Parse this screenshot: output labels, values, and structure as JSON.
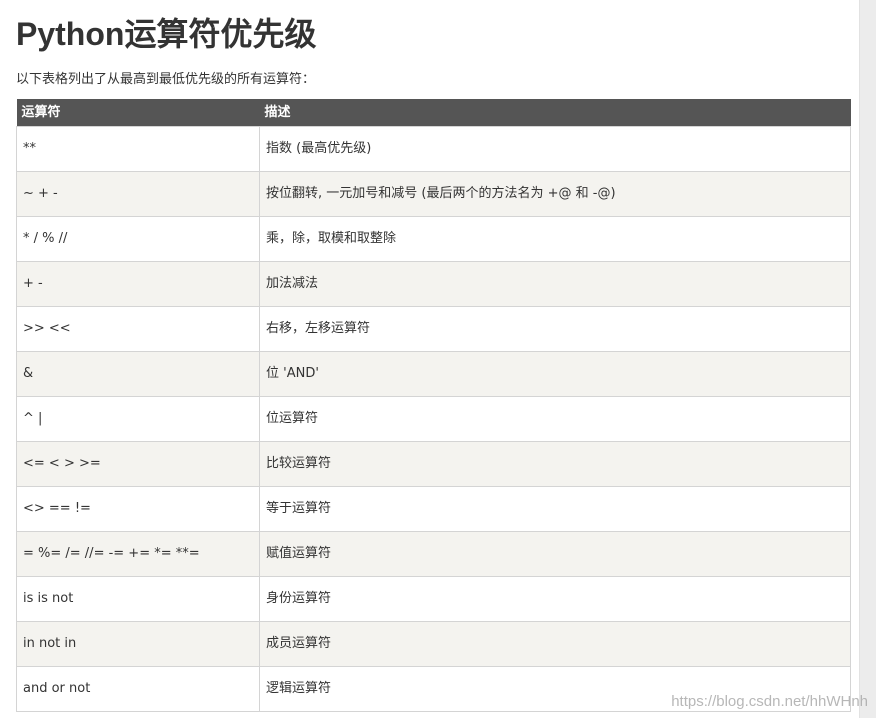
{
  "page": {
    "title": "Python运算符优先级",
    "intro": "以下表格列出了从最高到最低优先级的所有运算符："
  },
  "table": {
    "headers": [
      "运算符",
      "描述"
    ],
    "rows": [
      {
        "operator": "**",
        "description": "指数 (最高优先级)"
      },
      {
        "operator": "~ + -",
        "description": "按位翻转, 一元加号和减号 (最后两个的方法名为 +@ 和 -@)"
      },
      {
        "operator": "* / % //",
        "description": "乘，除，取模和取整除"
      },
      {
        "operator": "+ -",
        "description": "加法减法"
      },
      {
        "operator": ">> <<",
        "description": "右移，左移运算符"
      },
      {
        "operator": "&",
        "description": "位 'AND'"
      },
      {
        "operator": "^ |",
        "description": "位运算符"
      },
      {
        "operator": "<= < > >=",
        "description": "比较运算符"
      },
      {
        "operator": "<> == !=",
        "description": "等于运算符"
      },
      {
        "operator": "= %= /= //= -= += *= **=",
        "description": "赋值运算符"
      },
      {
        "operator": "is is not",
        "description": "身份运算符"
      },
      {
        "operator": "in not in",
        "description": "成员运算符"
      },
      {
        "operator": "and or not",
        "description": "逻辑运算符"
      }
    ]
  },
  "watermark": "https://blog.csdn.net/hhWHnh",
  "colors": {
    "header_bg": "#555555",
    "header_text": "#ffffff",
    "row_alt_bg": "#f4f3ef",
    "border": "#d4d4d4",
    "text": "#333333"
  }
}
